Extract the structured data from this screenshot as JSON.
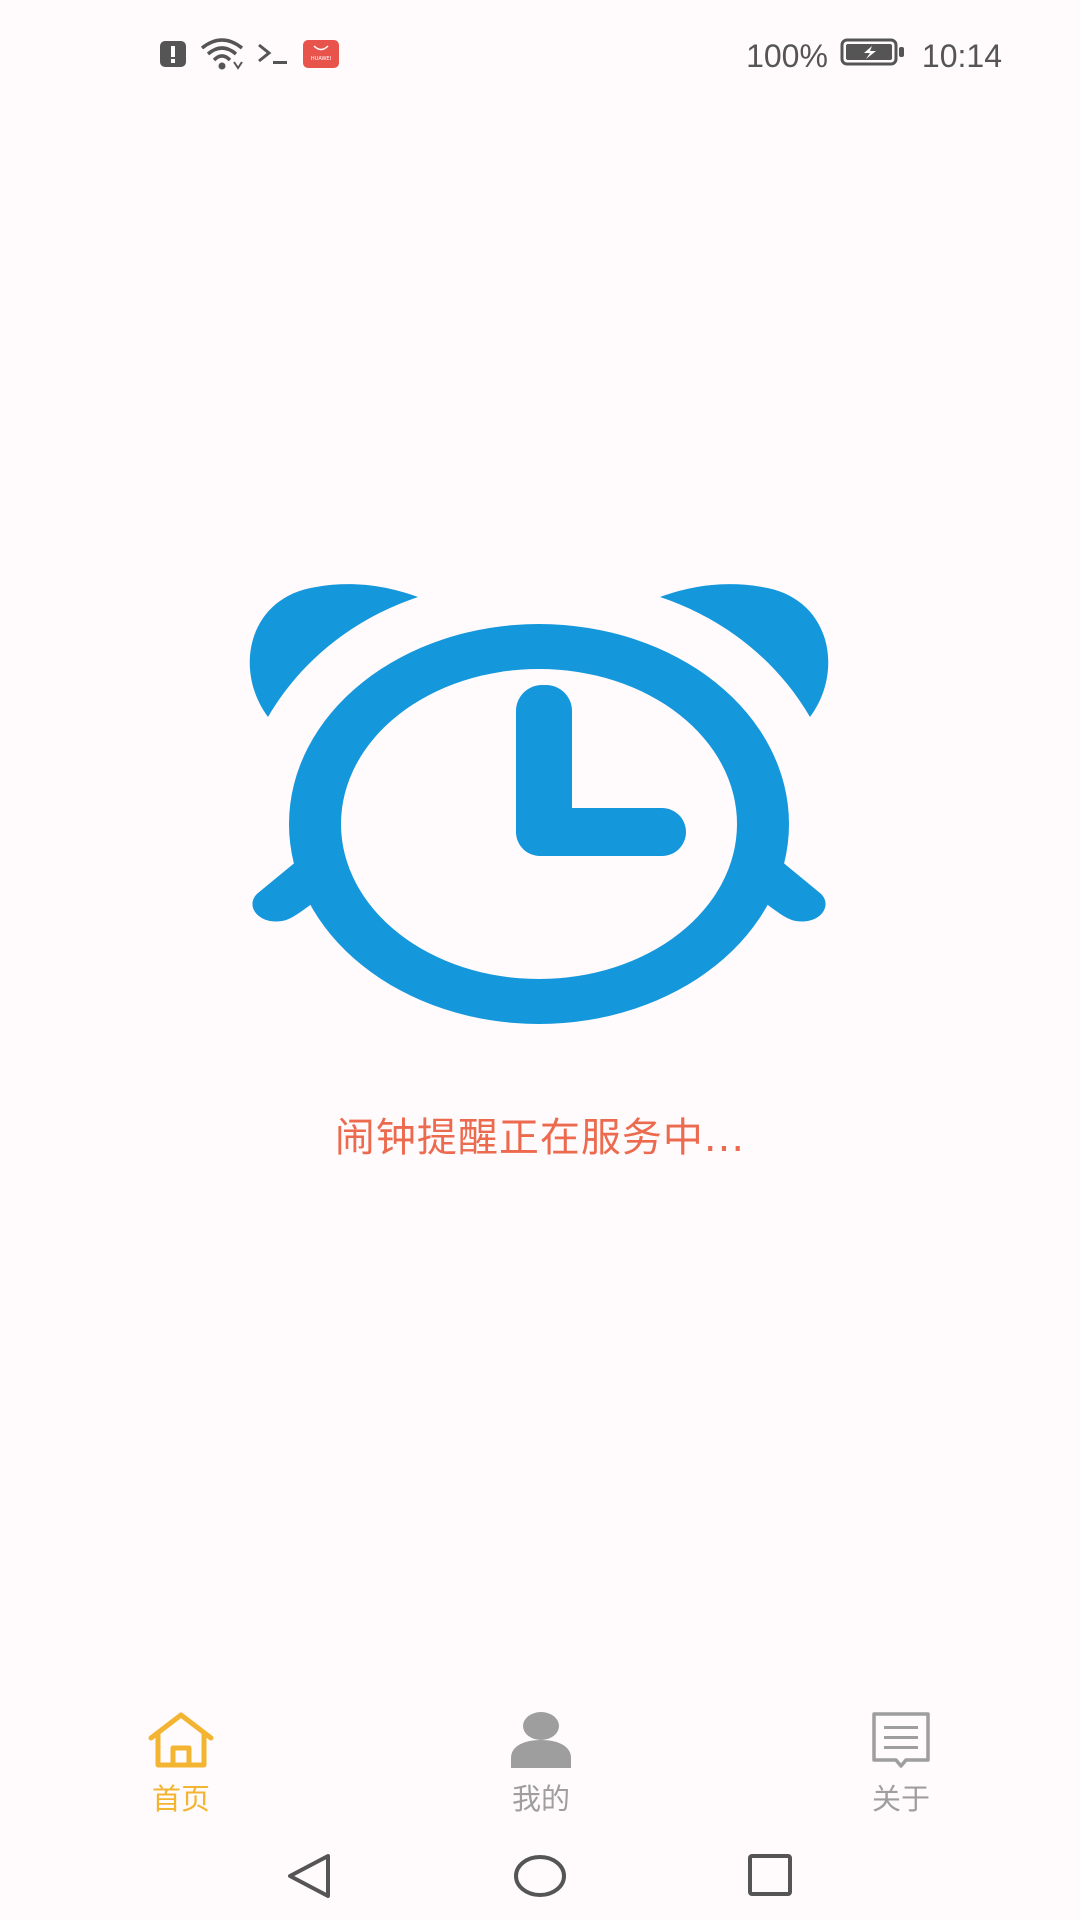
{
  "status_bar": {
    "battery_percent": "100%",
    "time": "10:14",
    "app_badge": "HUAWEI"
  },
  "main": {
    "service_text": "闹钟提醒正在服务中..."
  },
  "tabs": [
    {
      "label": "首页",
      "icon": "home-icon",
      "active": true
    },
    {
      "label": "我的",
      "icon": "person-icon",
      "active": false
    },
    {
      "label": "关于",
      "icon": "document-icon",
      "active": false
    }
  ],
  "colors": {
    "accent_active": "#f3b531",
    "inactive": "#9e9e9e",
    "clock_blue": "#1597dc",
    "service_text": "#ec6a4e"
  }
}
